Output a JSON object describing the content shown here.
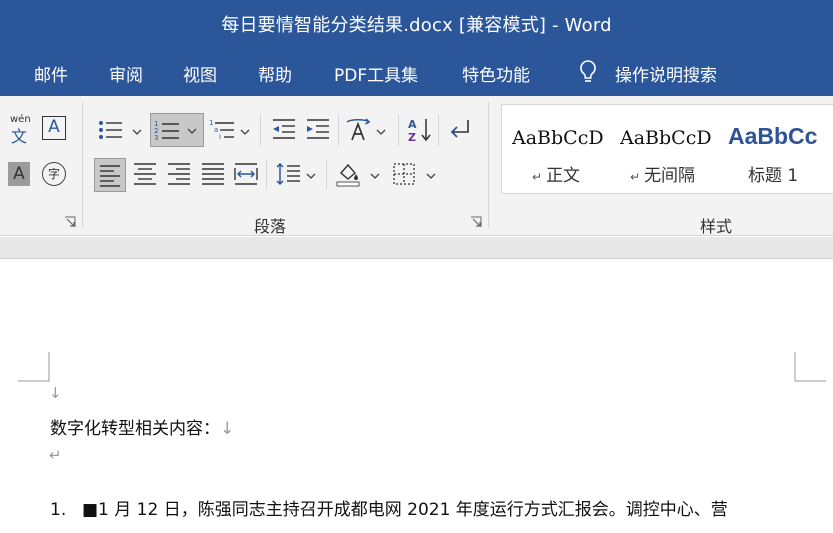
{
  "window": {
    "title": "每日要情智能分类结果.docx [兼容模式]  -  Word"
  },
  "menu": {
    "items": [
      "邮件",
      "审阅",
      "视图",
      "帮助",
      "PDF工具集",
      "特色功能"
    ],
    "tell_me": "操作说明搜索"
  },
  "ribbon": {
    "paragraph_group_label": "段落",
    "styles_group_label": "样式",
    "styles": [
      {
        "sample": "AaBbCcDd",
        "name": "正文"
      },
      {
        "sample": "AaBbCcDd",
        "name": "无间隔"
      },
      {
        "sample": "AaBbCc",
        "name": "标题 1"
      }
    ],
    "phonetic_label": "wén",
    "phonetic_char": "文",
    "border_char": "A",
    "shading_char": "A",
    "enclose_char": "字"
  },
  "document": {
    "paragraph_mark": "↓",
    "return_mark": "↵",
    "heading_line": "数字化转型相关内容：",
    "item_number": "1.",
    "item_text": "■1 月 12 日，陈强同志主持召开成都电网 2021 年度运行方式汇报会。调控中心、营"
  },
  "colors": {
    "title_bar": "#2b579a",
    "heading_style": "#2f5496"
  }
}
